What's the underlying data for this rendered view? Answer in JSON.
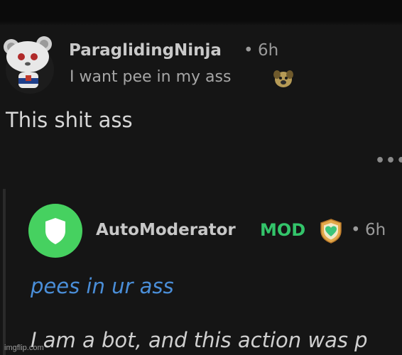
{
  "parent_comment": {
    "username": "ParaglidingNinja",
    "separator": "•",
    "time": "6h",
    "flair": "I want pee in my ass",
    "flair_icon": "dog-emoji-icon",
    "body": "This shit ass",
    "more_label": "•••",
    "avatar_icon": "snoo-avatar-icon"
  },
  "reply_comment": {
    "username": "AutoModerator",
    "mod_label": "MOD",
    "badge_icon": "heart-shield-icon",
    "separator": "•",
    "time": "6h",
    "body": "pees in ur ass",
    "bot_note": "I am a bot, and this action was p",
    "avatar_icon": "shield-avatar-icon"
  },
  "watermark": "imgflip.com",
  "colors": {
    "background": "#151515",
    "mod_green": "#33c46a",
    "link_blue": "#4a8ed8",
    "avatar_green": "#46d160"
  }
}
